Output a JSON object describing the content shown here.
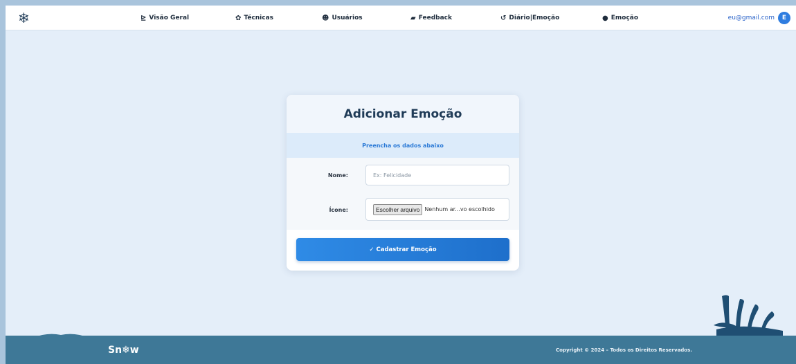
{
  "navbar": {
    "logo_icon": "snowflake-icon",
    "items": [
      {
        "label": "Visão Geral",
        "icon": "chart-icon",
        "glyph": "📈"
      },
      {
        "label": "Técnicas",
        "icon": "lotus-icon",
        "glyph": "❦"
      },
      {
        "label": "Usuários",
        "icon": "users-icon",
        "glyph": "👥"
      },
      {
        "label": "Feedback",
        "icon": "chat-icon",
        "glyph": "💬"
      },
      {
        "label": "Diário|Emoção",
        "icon": "history-icon",
        "glyph": "↺"
      },
      {
        "label": "Emoção",
        "icon": "circle-icon",
        "glyph": "●"
      }
    ],
    "user_email": "eu@gmail.com",
    "avatar_letter": "E"
  },
  "card": {
    "title": "Adicionar Emoção",
    "subtitle": "Preencha os dados abaixo",
    "name_label": "Nome:",
    "name_placeholder": "Ex: Felicidade",
    "icon_label": "Ícone:",
    "file_button": "Escolher arquivo",
    "file_status": "Nenhum ar...vo escolhido",
    "submit_label": "✓ Cadastrar Emoção"
  },
  "footer": {
    "brand": "Sn❄w",
    "copyright": "Copyright © 2024 – Todos os Direitos Reservados."
  },
  "colors": {
    "accent": "#2f7de0",
    "background": "#e4eef9",
    "footer": "#3e7897"
  }
}
